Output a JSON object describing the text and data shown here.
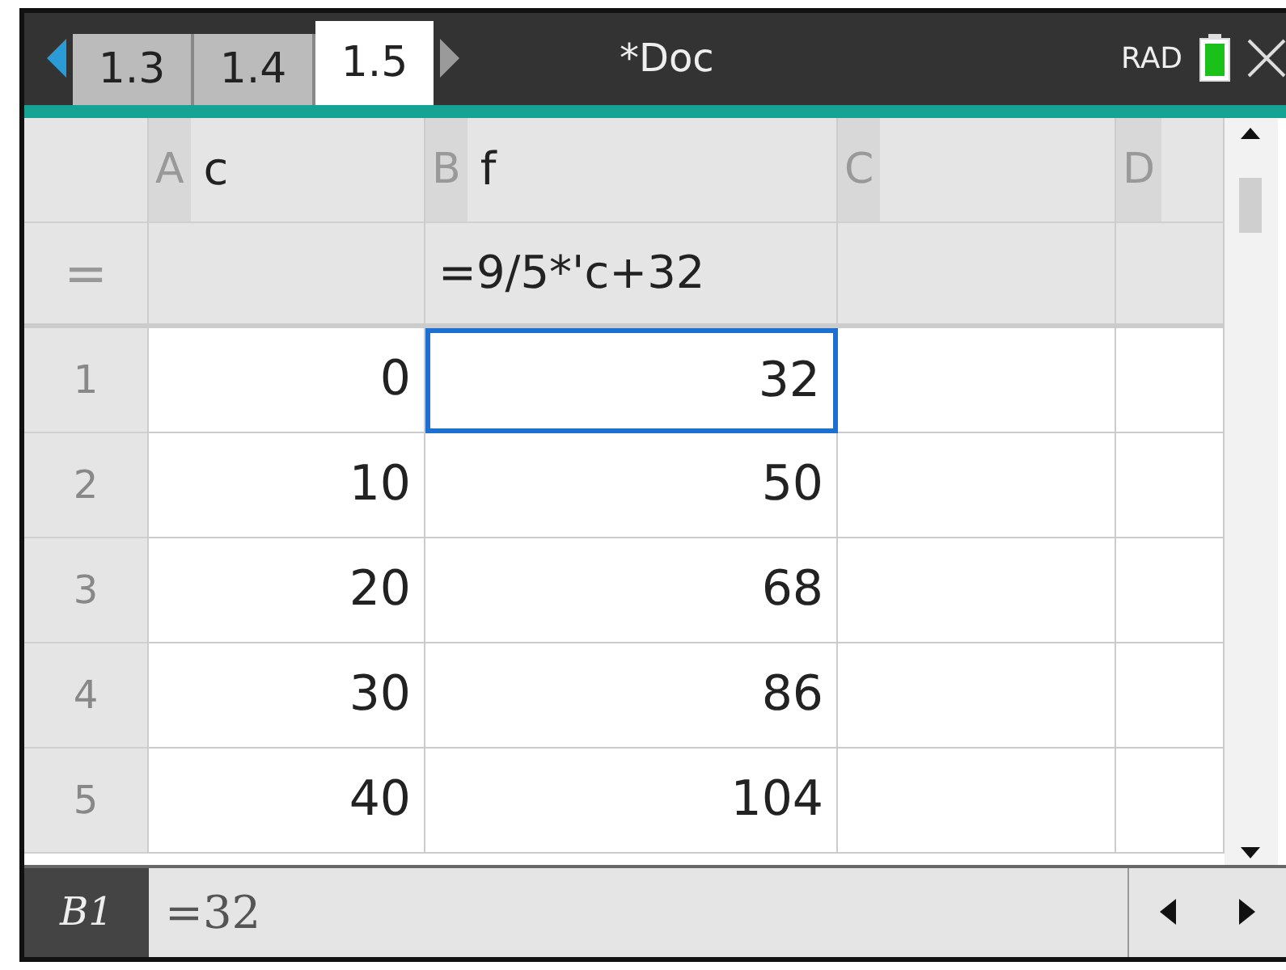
{
  "tabs": [
    {
      "label": "1.3",
      "selected": false
    },
    {
      "label": "1.4",
      "selected": false
    },
    {
      "label": "1.5",
      "selected": true
    }
  ],
  "title": "*Doc",
  "mode": "RAD",
  "columns": [
    {
      "letter": "A",
      "name": "c"
    },
    {
      "letter": "B",
      "name": "f"
    },
    {
      "letter": "C"
    },
    {
      "letter": "D"
    }
  ],
  "formula_row": {
    "marker": "=",
    "cells": [
      null,
      "=9/5*'c+32",
      null,
      null
    ]
  },
  "rows": [
    {
      "number": "1",
      "cells": [
        {
          "value": "0",
          "selected": false
        },
        {
          "value": "32",
          "selected": true
        },
        {
          "selected": false
        },
        {
          "selected": false
        }
      ]
    },
    {
      "number": "2",
      "cells": [
        {
          "value": "10",
          "selected": false
        },
        {
          "value": "50",
          "selected": false
        },
        {
          "selected": false
        },
        {
          "selected": false
        }
      ]
    },
    {
      "number": "3",
      "cells": [
        {
          "value": "20",
          "selected": false
        },
        {
          "value": "68",
          "selected": false
        },
        {
          "selected": false
        },
        {
          "selected": false
        }
      ]
    },
    {
      "number": "4",
      "cells": [
        {
          "value": "30",
          "selected": false
        },
        {
          "value": "86",
          "selected": false
        },
        {
          "selected": false
        },
        {
          "selected": false
        }
      ]
    },
    {
      "number": "5",
      "cells": [
        {
          "value": "40",
          "selected": false
        },
        {
          "value": "104",
          "selected": false
        },
        {
          "selected": false
        },
        {
          "selected": false
        }
      ]
    }
  ],
  "status_bar": {
    "cell_ref": "B1",
    "value": "=32"
  }
}
